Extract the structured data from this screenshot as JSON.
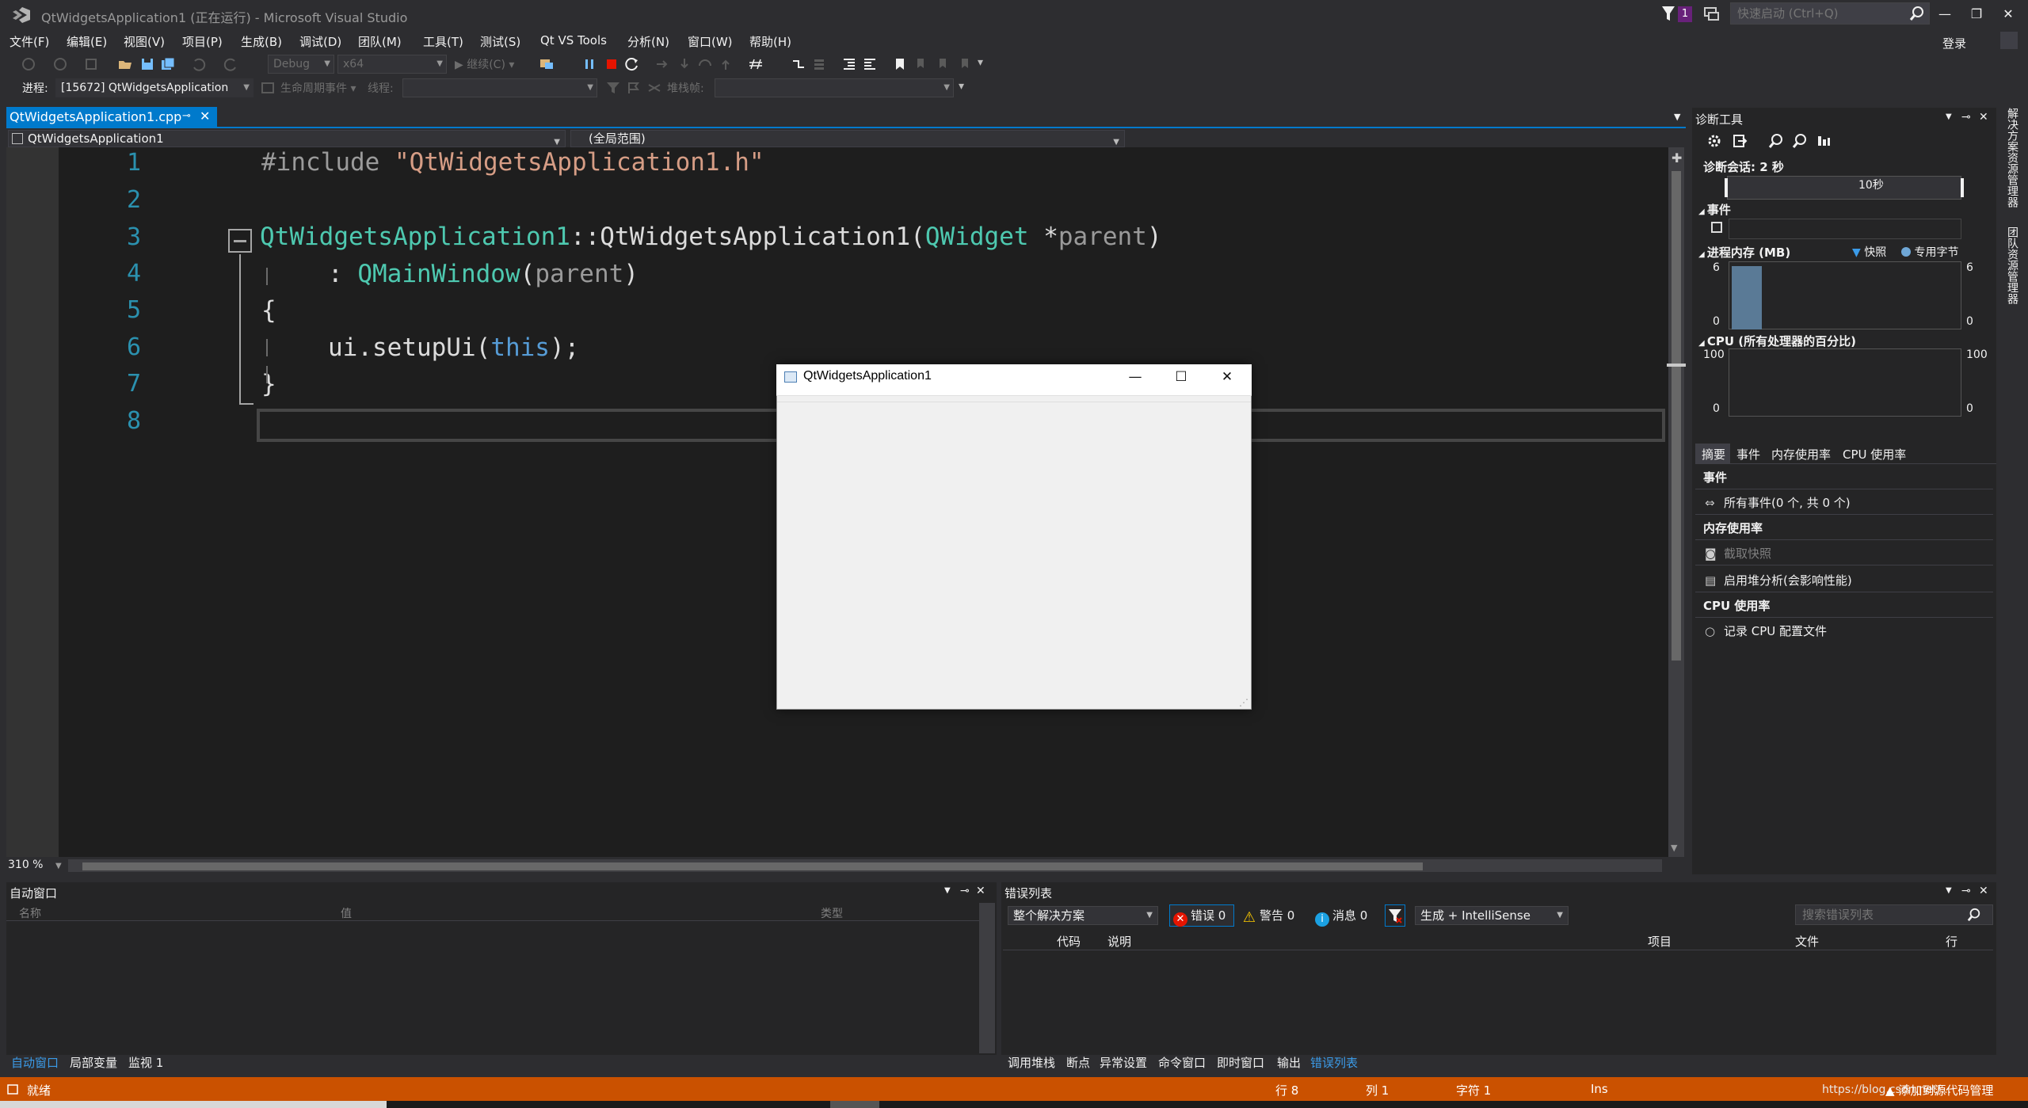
{
  "window": {
    "title": "QtWidgetsApplication1 (正在运行) - Microsoft Visual Studio",
    "notify_count": "1",
    "quick_launch_placeholder": "快速启动 (Ctrl+Q)",
    "login": "登录",
    "min": "—",
    "max": "❐",
    "close": "✕"
  },
  "menu": [
    "文件(F)",
    "编辑(E)",
    "视图(V)",
    "项目(P)",
    "生成(B)",
    "调试(D)",
    "团队(M)",
    "工具(T)",
    "测试(S)",
    "Qt VS Tools",
    "分析(N)",
    "窗口(W)",
    "帮助(H)"
  ],
  "toolbar": {
    "config": "Debug",
    "platform": "x64",
    "continue": "继续(C)",
    "process_label": "进程:",
    "process_value": "[15672] QtWidgetsApplication",
    "lifecycle": "生命周期事件",
    "thread_label": "线程:",
    "stack_label": "堆栈帧:"
  },
  "document": {
    "tab": "QtWidgetsApplication1.cpp",
    "nav_scope": "QtWidgetsApplication1",
    "nav_member": "(全局范围)",
    "zoom": "310 %",
    "lines": [
      "1",
      "2",
      "3",
      "4",
      "5",
      "6",
      "7",
      "8"
    ],
    "code": {
      "l1_pre": "#include ",
      "l1_str": "\"QtWidgetsApplication1.h\"",
      "l3_type": "QtWidgetsApplication1",
      "l3_sep": "::",
      "l3_fn": "QtWidgetsApplication1",
      "l3_open": "(",
      "l3_ptype": "QWidget",
      "l3_star": " *",
      "l3_param": "parent",
      "l3_close": ")",
      "l4_colon": ": ",
      "l4_base": "QMainWindow",
      "l4_open": "(",
      "l4_arg": "parent",
      "l4_close": ")",
      "l5": "{",
      "l6_a": "ui.setupUi(",
      "l6_kw": "this",
      "l6_b": ");",
      "l7": "}"
    }
  },
  "diagnostics": {
    "title": "诊断工具",
    "session": "诊断会话: 2 秒",
    "timeline_label": "10秒",
    "events_header": "事件",
    "memory_header": "进程内存 (MB)",
    "legend_snapshot": "快照",
    "legend_private": "专用字节",
    "mem_max": "6",
    "mem_min": "0",
    "cpu_header": "CPU (所有处理器的百分比)",
    "cpu_max": "100",
    "cpu_min": "0",
    "tabs": [
      "摘要",
      "事件",
      "内存使用率",
      "CPU 使用率"
    ],
    "rows": {
      "events_h": "事件",
      "all_events": "所有事件(0 个, 共 0 个)",
      "memory_h": "内存使用率",
      "take_snapshot": "截取快照",
      "heap_profiling": "启用堆分析(会影响性能)",
      "cpu_h": "CPU 使用率",
      "record_cpu": "记录 CPU 配置文件"
    }
  },
  "side_tabs": [
    "解决方案资源管理器",
    "团队资源管理器"
  ],
  "auto_window": {
    "title": "自动窗口",
    "columns": [
      "名称",
      "值",
      "类型"
    ],
    "tabs": [
      "自动窗口",
      "局部变量",
      "监视 1"
    ]
  },
  "error_list": {
    "title": "错误列表",
    "scope": "整个解决方案",
    "errors": "错误 0",
    "warnings": "警告 0",
    "messages": "消息 0",
    "build_filter": "生成 + IntelliSense",
    "search_placeholder": "搜索错误列表",
    "columns": [
      "代码",
      "说明",
      "项目",
      "文件",
      "行"
    ],
    "tabs": [
      "调用堆栈",
      "断点",
      "异常设置",
      "命令窗口",
      "即时窗口",
      "输出",
      "错误列表"
    ]
  },
  "status": {
    "ready": "就绪",
    "line": "行 8",
    "col": "列 1",
    "char": "字符 1",
    "ins": "Ins",
    "url": "https://blog.csdn.net/...",
    "source_control": "添加到源代码管理"
  },
  "qt_window": {
    "title": "QtWidgetsApplication1",
    "min": "—",
    "max": "☐",
    "close": "✕"
  },
  "colors": {
    "accent": "#007acc",
    "status_debug": "#ca5100",
    "editor_bg": "#1e1e1e",
    "chrome_bg": "#2d2d30"
  }
}
